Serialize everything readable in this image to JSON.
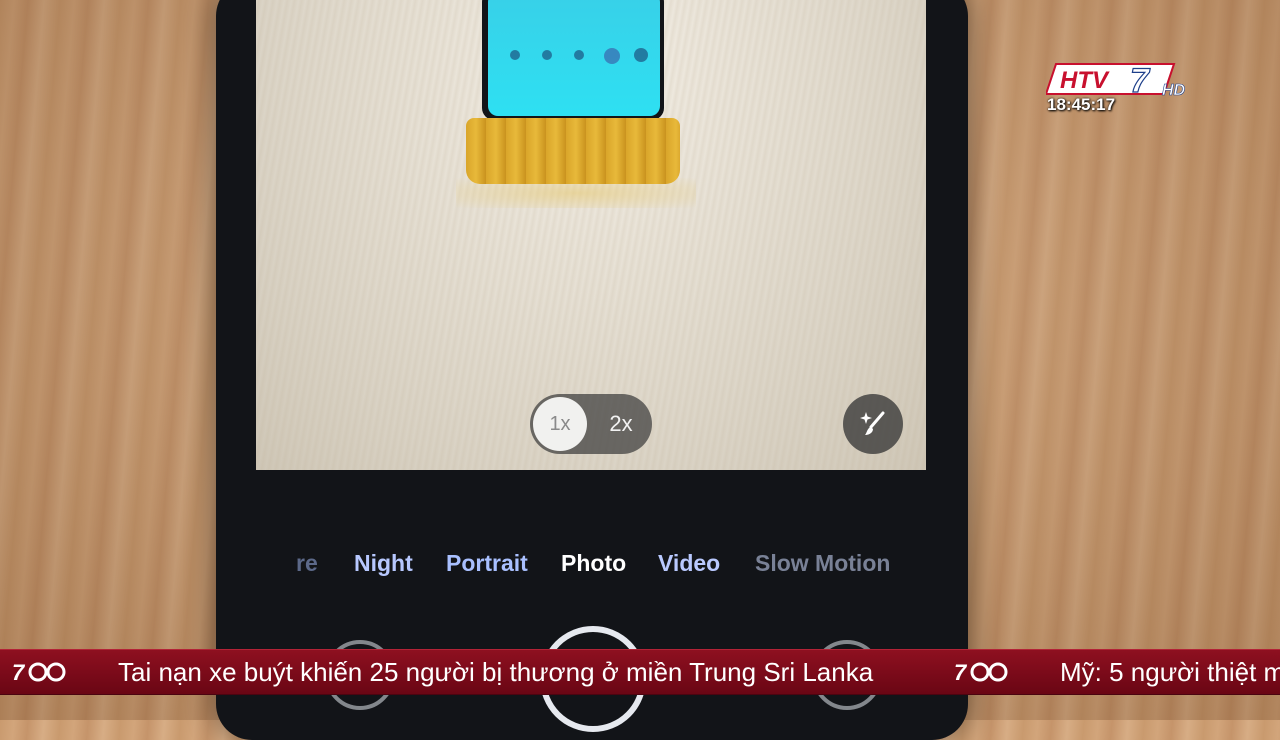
{
  "camera": {
    "zoom_options": [
      "1x",
      "2x"
    ],
    "modes": {
      "partial": "re",
      "night": "Night",
      "portrait": "Portrait",
      "photo": "Photo",
      "video": "Video",
      "slow_motion": "Slow Motion"
    },
    "selected_mode": "Photo"
  },
  "overlay": {
    "channel_logo": "HTV7 HD",
    "clock": "18:45:17"
  },
  "ticker": {
    "headline_1": "Tai nạn xe buýt khiến 25 người bị thương ở miền Trung Sri Lanka",
    "headline_2": "Mỹ: 5 người thiệt m"
  },
  "colors": {
    "ticker_bg": "#7a0a18",
    "active_mode": "#ffffff",
    "inactive_mode": "#b7c8ff"
  }
}
